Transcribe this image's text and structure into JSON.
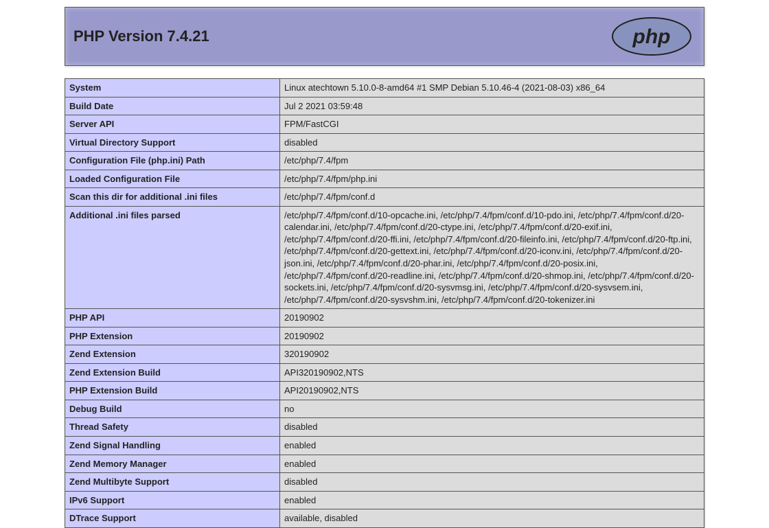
{
  "header": {
    "title": "PHP Version 7.4.21",
    "logo_text": "php"
  },
  "rows": [
    {
      "label": "System",
      "value": "Linux atechtown 5.10.0-8-amd64 #1 SMP Debian 5.10.46-4 (2021-08-03) x86_64"
    },
    {
      "label": "Build Date",
      "value": "Jul 2 2021 03:59:48"
    },
    {
      "label": "Server API",
      "value": "FPM/FastCGI"
    },
    {
      "label": "Virtual Directory Support",
      "value": "disabled"
    },
    {
      "label": "Configuration File (php.ini) Path",
      "value": "/etc/php/7.4/fpm"
    },
    {
      "label": "Loaded Configuration File",
      "value": "/etc/php/7.4/fpm/php.ini"
    },
    {
      "label": "Scan this dir for additional .ini files",
      "value": "/etc/php/7.4/fpm/conf.d"
    },
    {
      "label": "Additional .ini files parsed",
      "value": "/etc/php/7.4/fpm/conf.d/10-opcache.ini, /etc/php/7.4/fpm/conf.d/10-pdo.ini, /etc/php/7.4/fpm/conf.d/20-calendar.ini, /etc/php/7.4/fpm/conf.d/20-ctype.ini, /etc/php/7.4/fpm/conf.d/20-exif.ini, /etc/php/7.4/fpm/conf.d/20-ffi.ini, /etc/php/7.4/fpm/conf.d/20-fileinfo.ini, /etc/php/7.4/fpm/conf.d/20-ftp.ini, /etc/php/7.4/fpm/conf.d/20-gettext.ini, /etc/php/7.4/fpm/conf.d/20-iconv.ini, /etc/php/7.4/fpm/conf.d/20-json.ini, /etc/php/7.4/fpm/conf.d/20-phar.ini, /etc/php/7.4/fpm/conf.d/20-posix.ini, /etc/php/7.4/fpm/conf.d/20-readline.ini, /etc/php/7.4/fpm/conf.d/20-shmop.ini, /etc/php/7.4/fpm/conf.d/20-sockets.ini, /etc/php/7.4/fpm/conf.d/20-sysvmsg.ini, /etc/php/7.4/fpm/conf.d/20-sysvsem.ini, /etc/php/7.4/fpm/conf.d/20-sysvshm.ini, /etc/php/7.4/fpm/conf.d/20-tokenizer.ini"
    },
    {
      "label": "PHP API",
      "value": "20190902"
    },
    {
      "label": "PHP Extension",
      "value": "20190902"
    },
    {
      "label": "Zend Extension",
      "value": "320190902"
    },
    {
      "label": "Zend Extension Build",
      "value": "API320190902,NTS"
    },
    {
      "label": "PHP Extension Build",
      "value": "API20190902,NTS"
    },
    {
      "label": "Debug Build",
      "value": "no"
    },
    {
      "label": "Thread Safety",
      "value": "disabled"
    },
    {
      "label": "Zend Signal Handling",
      "value": "enabled"
    },
    {
      "label": "Zend Memory Manager",
      "value": "enabled"
    },
    {
      "label": "Zend Multibyte Support",
      "value": "disabled"
    },
    {
      "label": "IPv6 Support",
      "value": "enabled"
    },
    {
      "label": "DTrace Support",
      "value": "available, disabled"
    }
  ]
}
